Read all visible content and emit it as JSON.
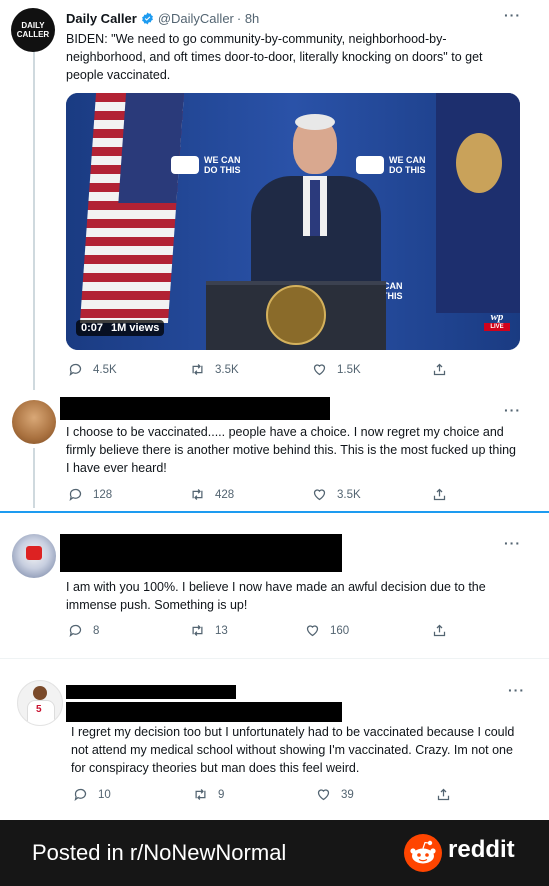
{
  "main_tweet": {
    "avatar_text": "DAILY CALLER",
    "name": "Daily Caller",
    "handle": "@DailyCaller",
    "time": "· 8h",
    "text": "BIDEN: \"We need to go community-by-community, neighborhood-by-neighborhood, and oft times door-to-door, literally knocking on doors\" to get people vaccinated.",
    "video": {
      "duration": "0:07",
      "views": "1M views",
      "backdrop_text": "WE CAN DO THIS",
      "wp_badge": "wp",
      "live_badge": "LIVE"
    },
    "replies": "4.5K",
    "retweets": "3.5K",
    "likes": "1.5K"
  },
  "replies": [
    {
      "text": "I choose to be vaccinated..... people have a choice. I now regret my choice and firmly believe there is another motive behind this. This is the most fucked up thing I have ever heard!",
      "replies": "128",
      "retweets": "428",
      "likes": "3.5K"
    },
    {
      "text": "I am with you 100%. I believe I now have made an awful decision due to the immense push. Something is up!",
      "replies": "8",
      "retweets": "13",
      "likes": "160"
    },
    {
      "text": "I regret my decision too but I unfortunately had to be vaccinated because I could not attend my medical school without showing I'm vaccinated. Crazy. Im not one for conspiracy theories but man does this feel weird.",
      "replies": "10",
      "retweets": "9",
      "likes": "39"
    }
  ],
  "footer": {
    "posted_in": "Posted in r/NoNewNormal",
    "brand": "reddit"
  },
  "colors": {
    "verified": "#1d9bf0",
    "divider": "#1d9bf0",
    "footer_bg": "#161616",
    "reddit_orange": "#ff4500"
  }
}
